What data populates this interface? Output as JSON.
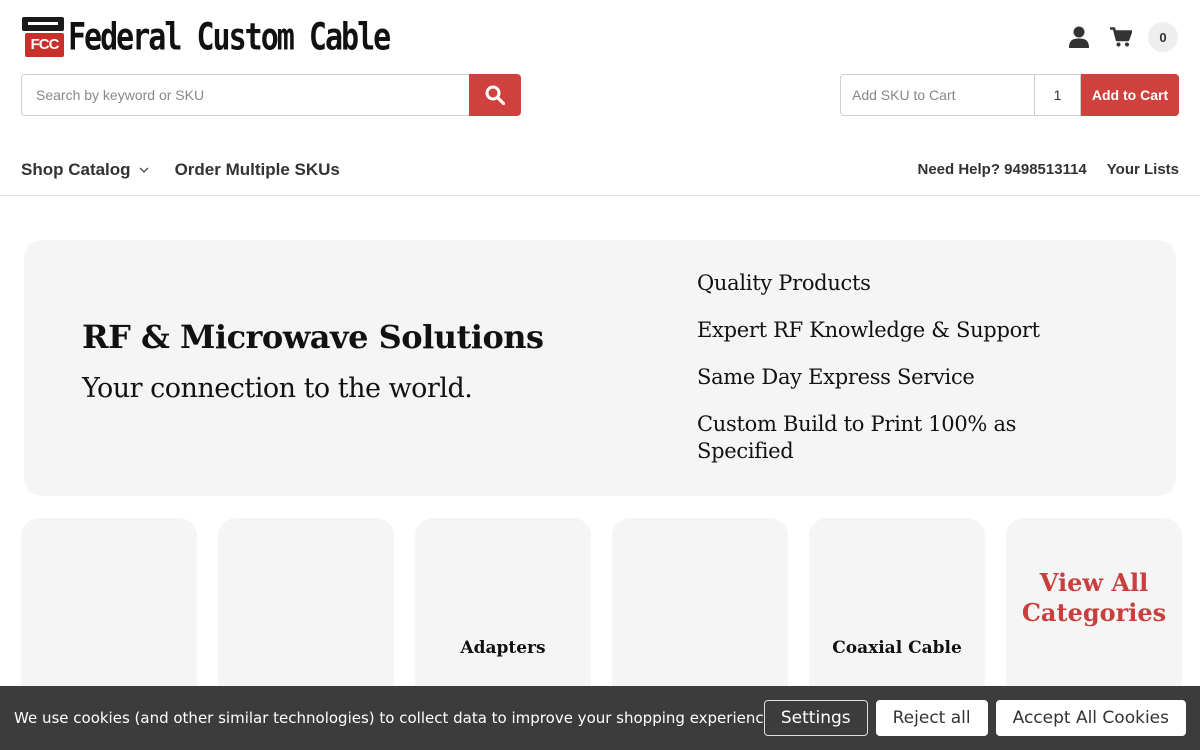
{
  "brand": {
    "logo_mark": "FCC",
    "logo_text": "Federal Custom Cable"
  },
  "header": {
    "cart_count": "0",
    "search": {
      "placeholder": "Search by keyword or SKU"
    },
    "sku": {
      "placeholder": "Add SKU to Cart",
      "qty": "1",
      "add_label": "Add to Cart"
    },
    "nav": {
      "shop_catalog": "Shop Catalog",
      "order_multiple": "Order Multiple SKUs",
      "need_help": "Need Help? 9498513114",
      "your_lists": "Your Lists"
    }
  },
  "hero": {
    "title": "RF & Microwave Solutions",
    "subtitle": "Your connection to the world.",
    "features": [
      "Quality Products",
      "Expert RF Knowledge & Support",
      "Same Day Express Service",
      "Custom Build to Print 100% as Specified"
    ]
  },
  "categories": [
    {
      "label": ""
    },
    {
      "label": ""
    },
    {
      "label": "Adapters"
    },
    {
      "label": ""
    },
    {
      "label": "Coaxial Cable"
    },
    {
      "label": "View All Categories"
    }
  ],
  "cookie": {
    "message": "We use cookies (and other similar technologies) to collect data to improve your shopping experience.",
    "settings": "Settings",
    "reject": "Reject all",
    "accept": "Accept All Cookies"
  },
  "colors": {
    "accent": "#d0403d",
    "hero_bg": "#f5f5f5",
    "cookie_bg": "#3c3c3c"
  }
}
